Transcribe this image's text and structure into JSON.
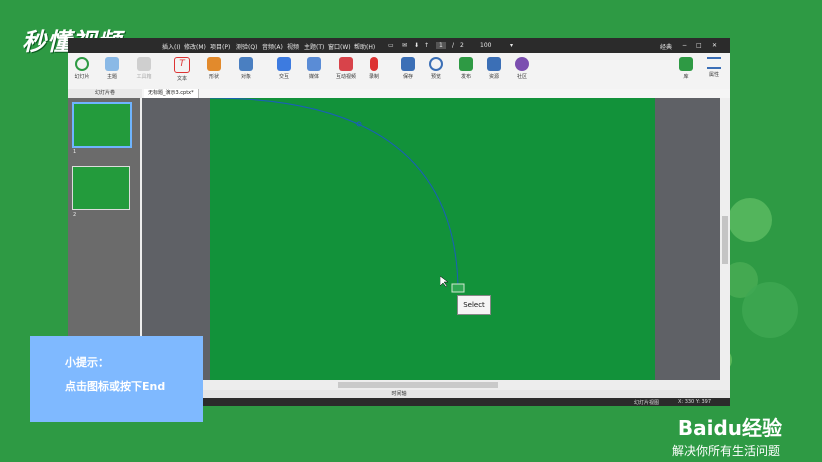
{
  "watermark": {
    "logo": "秒懂视频"
  },
  "menubar": {
    "items": [
      "插入(I)",
      "修改(M)",
      "项目(P)",
      "测验(Q)",
      "音频(A)",
      "视频",
      "主题(T)",
      "窗口(W)",
      "帮助(H)"
    ],
    "page_current": "1",
    "page_total": "2",
    "page_sep": "/",
    "zoom": "100",
    "mode": "经典"
  },
  "toolbar": {
    "items": [
      "幻灯片",
      "主题",
      "工具箱",
      "文本",
      "形状",
      "对象",
      "交互",
      "媒体",
      "互动视频",
      "录制",
      "保存",
      "预览",
      "发布",
      "资源",
      "社区"
    ],
    "right": [
      "库",
      "属性"
    ]
  },
  "panel": {
    "title": "幻灯片卷"
  },
  "tab": {
    "label": "无标题_演示3.cptx*"
  },
  "slides": [
    {
      "num": "1"
    },
    {
      "num": "2"
    }
  ],
  "popup": {
    "label": "Select"
  },
  "status": {
    "center": "时间轴",
    "view": "幻灯片视图",
    "coords": "X: 330 Y: 397"
  },
  "tip": {
    "title": "小提示：",
    "text": "点击图标或按下End"
  },
  "baidu": {
    "logo": "Baidu经验",
    "tagline": "解决你所有生活问题"
  },
  "colors": {
    "slide_bg": "#12923a",
    "page_bg": "#2e9a44",
    "tip_bg": "#7fb9ff",
    "path_stroke": "#1a5fb8"
  }
}
